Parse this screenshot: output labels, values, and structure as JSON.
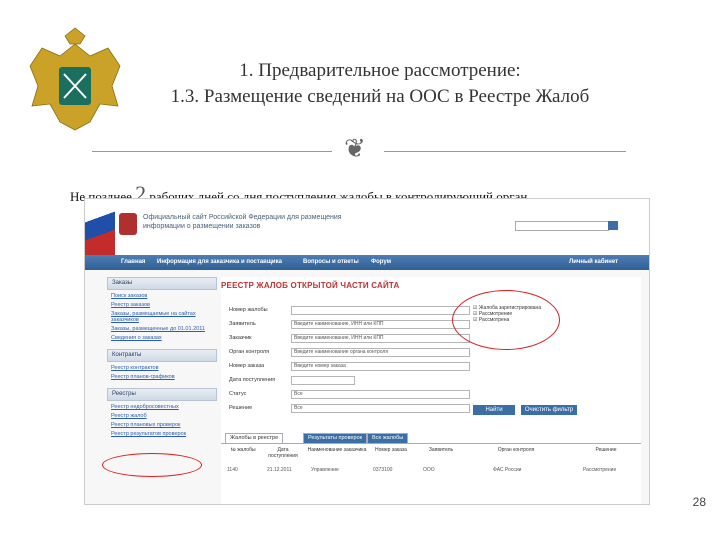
{
  "slide": {
    "title_line1": "1. Предварительное рассмотрение:",
    "title_line2": "1.3. Размещение сведений на ООС в Реестре Жалоб",
    "subtitle_prefix": "Не позднее",
    "subtitle_number": "2",
    "subtitle_suffix": "рабочих дней со дня поступления жалобы в контролирующий орган",
    "page_number": "28"
  },
  "screenshot": {
    "site_title": "Официальный сайт Российской Федерации для размещения информации о размещении заказов",
    "nav_items": [
      "Главная",
      "Информация для заказчика и поставщика",
      "Вопросы и ответы",
      "Форум",
      "Личный кабинет"
    ],
    "sidebar": {
      "sections": [
        {
          "title": "Заказы",
          "links": [
            "Поиск заказов",
            "Реестр заказов",
            "Заказы, размещаемые на сайтах заказчиков",
            "Заказы, размещенные до 01.01.2011",
            "Сведения о заказах"
          ]
        },
        {
          "title": "Контракты",
          "links": [
            "Реестр контрактов",
            "Реестр планов-графиков"
          ]
        },
        {
          "title": "Реестры",
          "links": [
            "Реестр недобросовестных",
            "Реестр жалоб",
            "Реестр плановых проверок",
            "Реестр результатов проверок"
          ]
        }
      ]
    },
    "main": {
      "registry_title": "РЕЕСТР ЖАЛОБ ОТКРЫТОЙ ЧАСТИ САЙТА",
      "form_rows": [
        {
          "label": "Номер жалобы",
          "value": ""
        },
        {
          "label": "Заявитель",
          "value": "Введите наименование, ИНН или КПП"
        },
        {
          "label": "Заказчик",
          "value": "Введите наименование, ИНН или КПП"
        },
        {
          "label": "Орган контроля",
          "value": "Введите наименование органа контроля"
        },
        {
          "label": "Номер заказа",
          "value": "Введите номер заказа"
        },
        {
          "label": "Дата поступления",
          "value": ""
        },
        {
          "label": "Статус",
          "value": "Все"
        },
        {
          "label": "Решение",
          "value": "Все"
        }
      ],
      "status_checkboxes": [
        "Жалоба зарегистрирована",
        "Рассмотрение",
        "Рассмотрена"
      ],
      "search_button": "Найти",
      "clear_button": "Очистить фильтр",
      "tabs": [
        "Жалобы в реестре",
        "Результаты проверок",
        "Все жалобы"
      ],
      "table_headers": [
        "№ жалобы",
        "Дата поступления",
        "Наименование заказчика",
        "Номер заказа",
        "Заявитель",
        "Орган контроля",
        "Решение"
      ],
      "table_rows": [
        {
          "num": "1140",
          "date": "21.12.2011",
          "customer": "Управление",
          "order": "0373100",
          "applicant": "ООО",
          "organ": "ФАС России",
          "decision": "Рассмотрение"
        }
      ]
    }
  },
  "colors": {
    "annotation_red": "#d62020",
    "nav_blue": "#3a6ea5",
    "link_blue": "#2a5db0"
  }
}
